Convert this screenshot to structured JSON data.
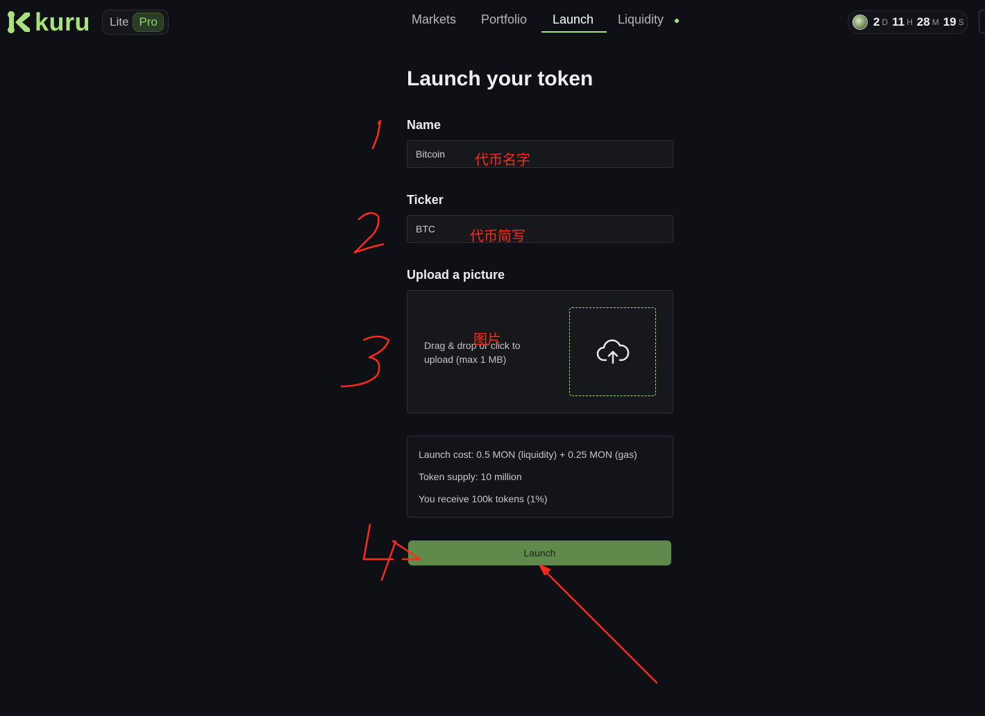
{
  "header": {
    "logo_text": "kuru",
    "mode_toggle": {
      "lite_label": "Lite",
      "pro_label": "Pro",
      "selected": "Pro"
    },
    "nav": [
      {
        "label": "Markets"
      },
      {
        "label": "Portfolio"
      },
      {
        "label": "Launch",
        "active": true
      },
      {
        "label": "Liquidity"
      }
    ],
    "timer": {
      "days": "2",
      "days_unit": "D",
      "hours": "11",
      "hours_unit": "H",
      "minutes": "28",
      "minutes_unit": "M",
      "seconds": "19",
      "seconds_unit": "S"
    }
  },
  "form": {
    "title": "Launch your token",
    "name_label": "Name",
    "name_placeholder": "Bitcoin",
    "ticker_label": "Ticker",
    "ticker_placeholder": "BTC",
    "upload_label": "Upload a picture",
    "upload_hint_line1": "Drag & drop or click to",
    "upload_hint_line2": "upload (max 1 MB)",
    "upload_icon": "cloud-upload-icon",
    "info": [
      "Launch cost: 0.5 MON (liquidity) + 0.25 MON (gas)",
      "Token supply: 10 million",
      "You receive 100k tokens (1%)"
    ],
    "launch_label": "Launch"
  },
  "annotations": {
    "name_note": "代币名字",
    "ticker_note": "代币简写",
    "picture_note": "图片",
    "step_numbers": [
      "1",
      "2",
      "3",
      "4"
    ],
    "ink_color": "#ff2a1a"
  },
  "colors": {
    "accent": "#a9e17c",
    "background": "#0e1016",
    "button": "#5f8a4c"
  }
}
